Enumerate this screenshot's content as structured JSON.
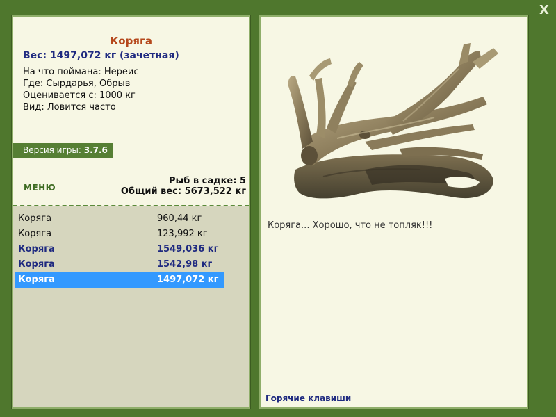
{
  "fish": {
    "name": "Коряга",
    "weight": "Вес: 1497,072 кг (зачетная)",
    "caught_on": "На что поймана: Нереис",
    "location": "Где: Сырдарья, Обрыв",
    "rated_from": "Оценивается с: 1000 кг",
    "kind": "Вид: Ловится часто",
    "comment": "Коряга... Хорошо, что не топляк!!!"
  },
  "version": {
    "label": "Версия игры:",
    "value": "3.7.6"
  },
  "menu_label": "МЕНЮ",
  "keepnet": {
    "count_label": "Рыб в садке: 5",
    "total_label": "Общий вес: 5673,522 кг",
    "items": [
      {
        "name": "Коряга",
        "weight": "960,44 кг",
        "style": "plain"
      },
      {
        "name": "Коряга",
        "weight": "123,992 кг",
        "style": "plain"
      },
      {
        "name": "Коряга",
        "weight": "1549,036 кг",
        "style": "bold"
      },
      {
        "name": "Коряга",
        "weight": "1542,98 кг",
        "style": "bold"
      },
      {
        "name": "Коряга",
        "weight": "1497,072 кг",
        "style": "selected"
      }
    ]
  },
  "hotkeys_label": "Горячие клавиши",
  "close_label": "X",
  "colors": {
    "background": "#4f772d",
    "panel": "#f7f7e4",
    "list_bg": "#d6d6be",
    "title": "#b5481c",
    "highlight": "#3399ff",
    "navy": "#1f2a80"
  },
  "image": {
    "subject": "driftwood"
  }
}
